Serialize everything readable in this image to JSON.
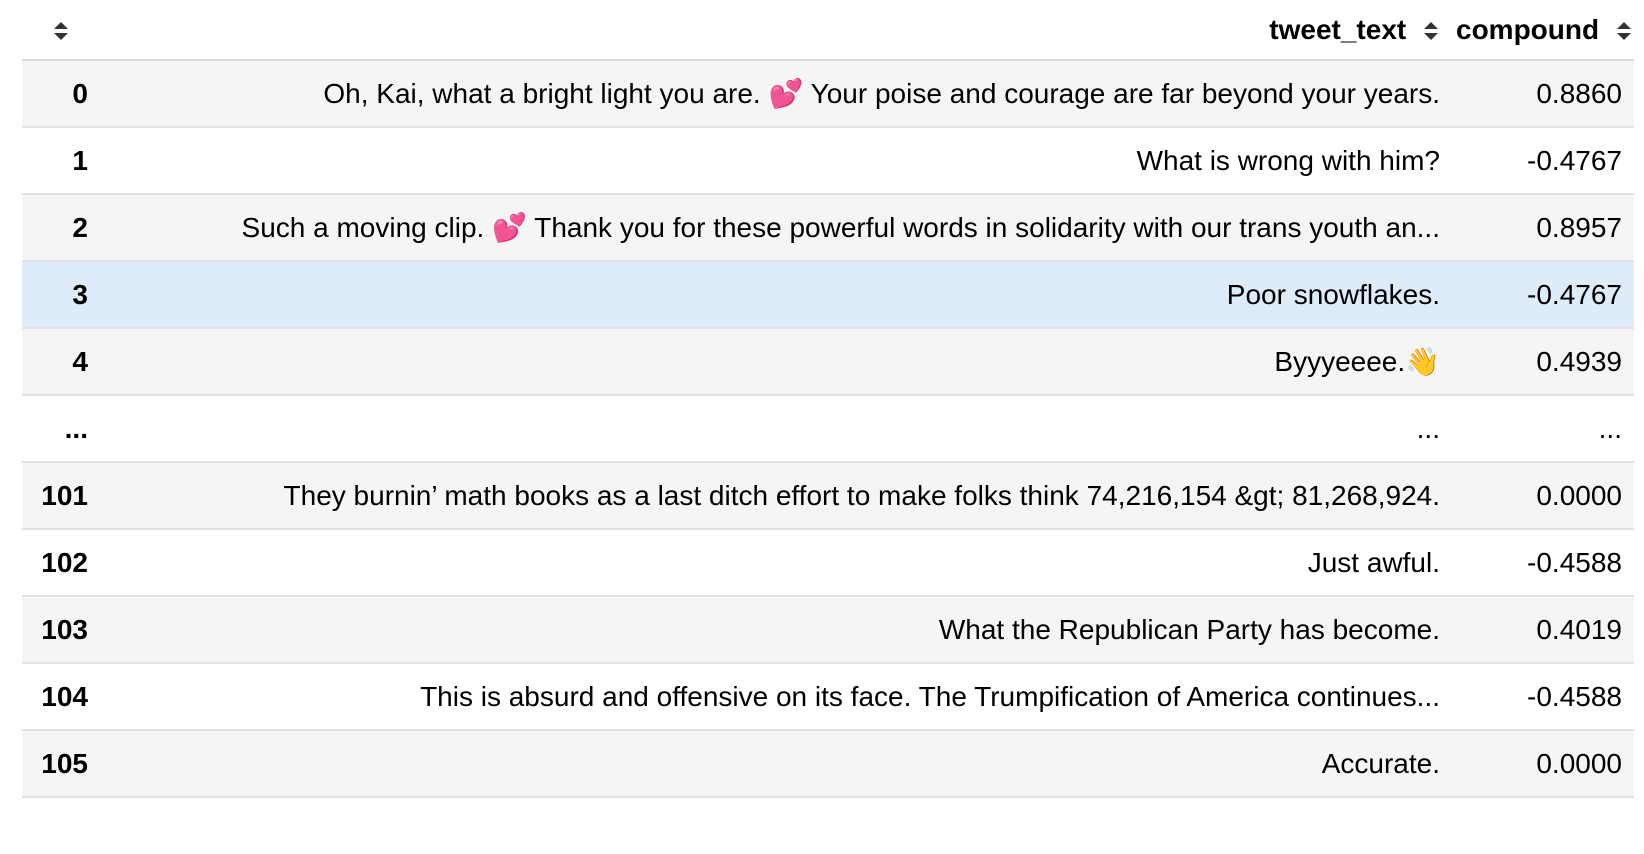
{
  "table": {
    "columns": [
      {
        "key": "index",
        "label": ""
      },
      {
        "key": "tweet_text",
        "label": "tweet_text"
      },
      {
        "key": "compound",
        "label": "compound"
      }
    ],
    "rows": [
      {
        "index": "0",
        "tweet_text": "Oh, Kai, what a bright light you are. 💕 Your poise and courage are far beyond your years.",
        "compound": "0.8860"
      },
      {
        "index": "1",
        "tweet_text": "What is wrong with him?",
        "compound": "-0.4767"
      },
      {
        "index": "2",
        "tweet_text": "Such a moving clip. 💕 Thank you for these powerful words in solidarity with our trans youth an...",
        "compound": "0.8957"
      },
      {
        "index": "3",
        "tweet_text": "Poor snowflakes.",
        "compound": "-0.4767",
        "selected": true
      },
      {
        "index": "4",
        "tweet_text": "Byyyeeee.👋",
        "compound": "0.4939"
      },
      {
        "index": "...",
        "tweet_text": "...",
        "compound": "..."
      },
      {
        "index": "101",
        "tweet_text": "They burnin’ math books as a last ditch effort to make folks think 74,216,154 &gt; 81,268,924.",
        "compound": "0.0000"
      },
      {
        "index": "102",
        "tweet_text": "Just awful.",
        "compound": "-0.4588"
      },
      {
        "index": "103",
        "tweet_text": "What the Republican Party has become.",
        "compound": "0.4019"
      },
      {
        "index": "104",
        "tweet_text": "This is absurd and offensive on its face. The Trumpification of America continues...",
        "compound": "-0.4588"
      },
      {
        "index": "105",
        "tweet_text": "Accurate.",
        "compound": "0.0000"
      }
    ]
  },
  "icons": {
    "sort": "sort-updown-icon"
  },
  "colors": {
    "row_odd": "#f5f5f5",
    "row_even": "#ffffff",
    "row_selected": "#deebf9",
    "border": "#e2e2e2"
  }
}
